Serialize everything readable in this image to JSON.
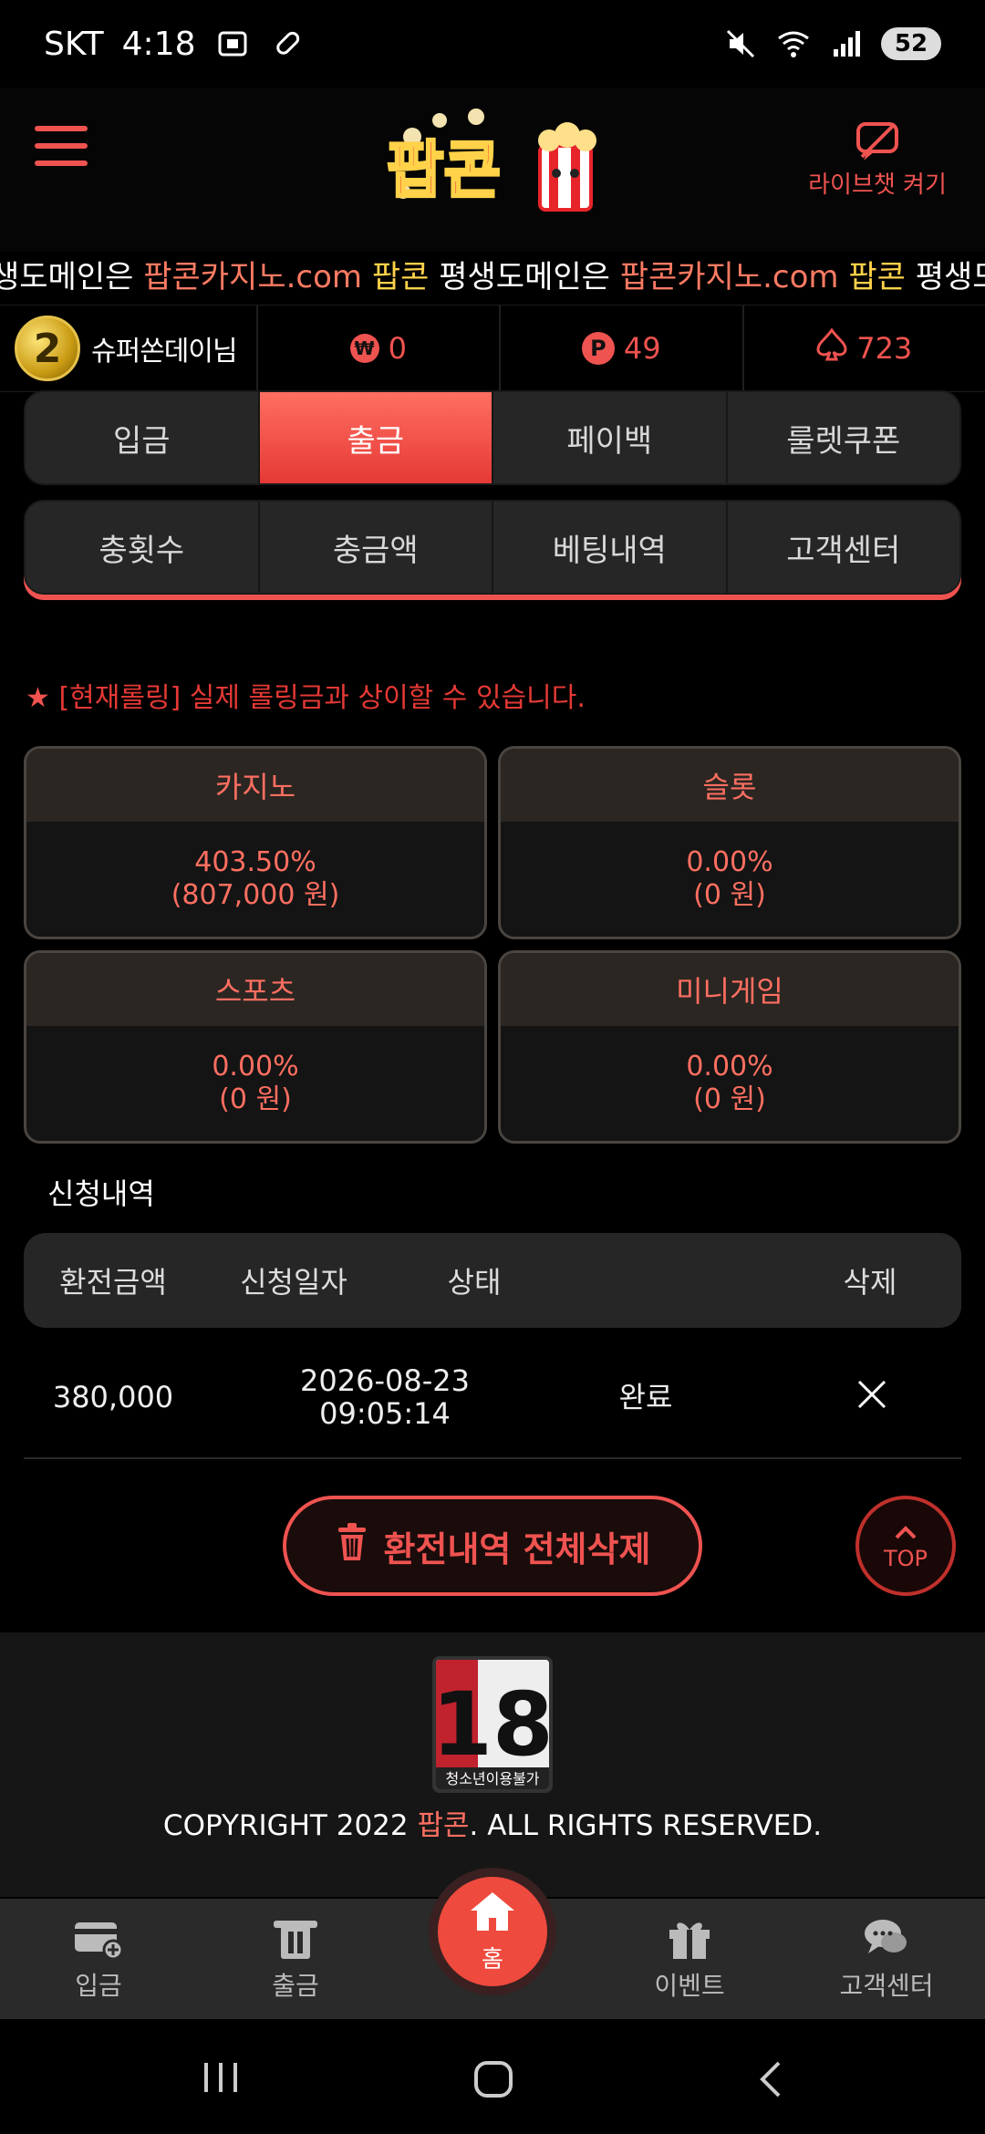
{
  "status_bar": {
    "carrier": "SKT",
    "time": "4:18",
    "battery": "52"
  },
  "header": {
    "livechat_label": "라이브챗 켜기",
    "logo_text": "팝콘"
  },
  "marquee": {
    "segments": [
      {
        "text": "생도메인은 ",
        "color": "white"
      },
      {
        "text": "팝콘카지노.com",
        "color": "red"
      },
      {
        "text": " 팝콘",
        "color": "yellow"
      },
      {
        "text": " 평생도메인은 ",
        "color": "white"
      },
      {
        "text": "팝콘카지노.com",
        "color": "red"
      },
      {
        "text": " 팝콘",
        "color": "yellow"
      },
      {
        "text": " 평생도메",
        "color": "white"
      }
    ]
  },
  "user": {
    "level": "2",
    "name": "슈퍼쏜데이님",
    "won": "0",
    "points": "49",
    "spade": "723"
  },
  "tabs_main": [
    {
      "label": "입금",
      "active": false
    },
    {
      "label": "출금",
      "active": true
    },
    {
      "label": "페이백",
      "active": false
    },
    {
      "label": "룰렛쿠폰",
      "active": false
    }
  ],
  "tabs_sub": [
    {
      "label": "충횟수"
    },
    {
      "label": "충금액"
    },
    {
      "label": "베팅내역"
    },
    {
      "label": "고객센터"
    }
  ],
  "notice": {
    "star": "★",
    "prefix": "[현재롤링]",
    "text": " 실제 롤링금과 상이할 수 있습니다."
  },
  "rolling": [
    {
      "title": "카지노",
      "percent": "403.50%",
      "amount": "(807,000 원)"
    },
    {
      "title": "슬롯",
      "percent": "0.00%",
      "amount": "(0 원)"
    },
    {
      "title": "스포츠",
      "percent": "0.00%",
      "amount": "(0 원)"
    },
    {
      "title": "미니게임",
      "percent": "0.00%",
      "amount": "(0 원)"
    }
  ],
  "history": {
    "title": "신청내역",
    "headers": [
      "환전금액",
      "신청일자",
      "상태",
      "삭제"
    ],
    "rows": [
      {
        "amount": "380,000",
        "date": "2026-08-23",
        "time": "09:05:14",
        "status": "완료"
      }
    ]
  },
  "delete_all_label": "환전내역 전체삭제",
  "top_label": "TOP",
  "footer": {
    "badge_number": "18",
    "badge_text": "청소년이용불가",
    "copyright_pre": "COPYRIGHT 2022 ",
    "copyright_brand": "팝콘",
    "copyright_post": ". ALL RIGHTS RESERVED."
  },
  "bottom_nav": {
    "deposit": "입금",
    "withdraw": "출금",
    "home": "홈",
    "event": "이벤트",
    "support": "고객센터"
  },
  "colors": {
    "accent": "#ef5350",
    "background": "#000000",
    "panel": "#262626",
    "yellow": "#ffd24a"
  }
}
